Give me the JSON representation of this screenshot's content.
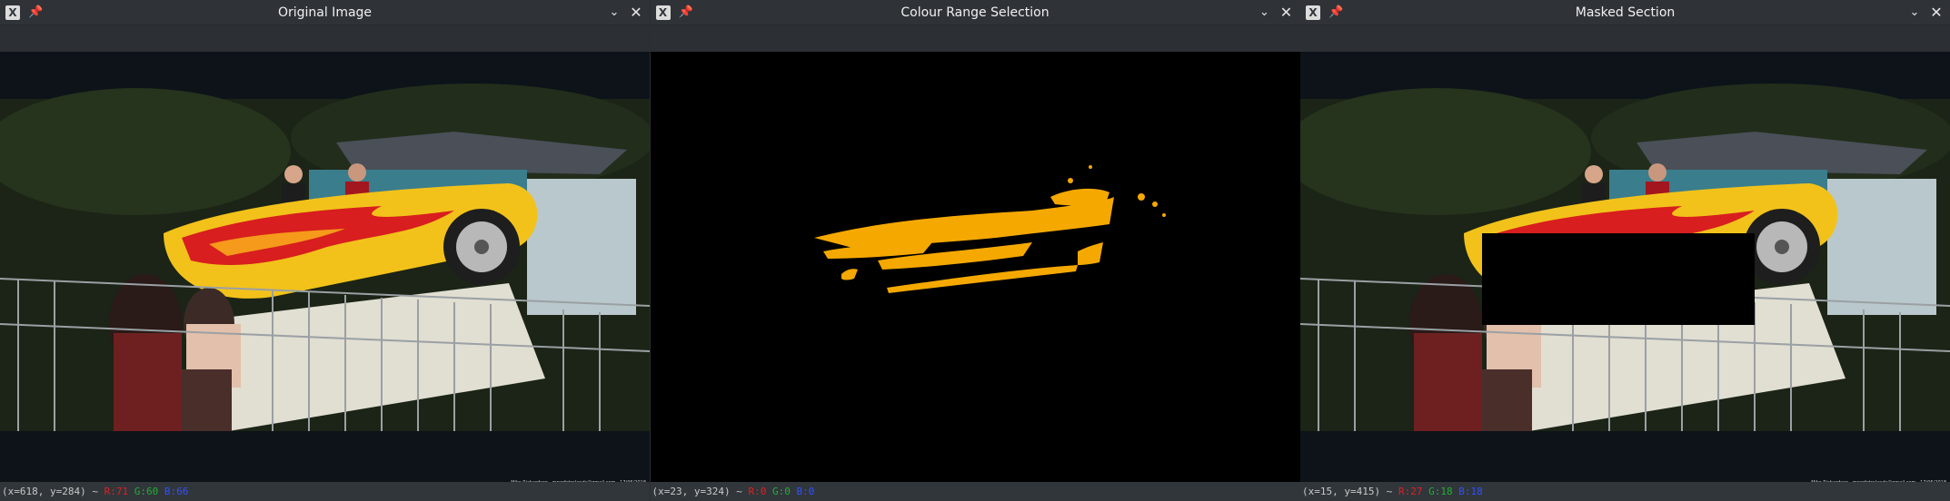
{
  "windows": [
    {
      "title": "Original Image",
      "status": {
        "coord": "(x=618, y=284) ~",
        "r": "R:71",
        "g": "G:60",
        "b": "B:66"
      },
      "credit": "Mike Richardson  ·  mperfotrelands@gmail.com  ·  17/06/2018"
    },
    {
      "title": "Colour Range Selection",
      "status": {
        "coord": "(x=23, y=324) ~",
        "r": "R:0",
        "g": "G:0",
        "b": "B:0"
      },
      "credit": ""
    },
    {
      "title": "Masked Section",
      "status": {
        "coord": "(x=15, y=415) ~",
        "r": "R:27",
        "g": "G:18",
        "b": "B:18"
      },
      "credit": "Mike Richardson  ·  mperfotrelands@gmail.com  ·  17/06/2018"
    }
  ],
  "icons": {
    "app": "x-app-icon",
    "pin": "pin-icon",
    "minimize": "chevron-down-icon",
    "close": "close-icon"
  },
  "colors": {
    "flame_selection": "#f5a800",
    "car_yellow": "#f2c21a",
    "mask": "#000000"
  }
}
